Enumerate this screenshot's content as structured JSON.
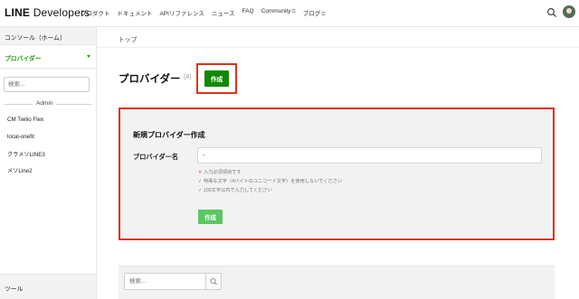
{
  "brand": {
    "line": "LINE",
    "developers": "Developers"
  },
  "nav": {
    "products": "プロダクト",
    "docs": "ドキュメント",
    "api": "APIリファレンス",
    "news": "ニュース",
    "faq": "FAQ",
    "community": "Community",
    "blog": "ブログ"
  },
  "sidebar": {
    "console": "コンソール（ホーム）",
    "providers": "プロバイダー",
    "search_placeholder": "検索...",
    "admin_label": "Admin",
    "items": [
      "CM Twilio Flex",
      "local-onefit",
      "クラメソLINE3",
      "メソLine2"
    ],
    "tools": "ツール"
  },
  "main": {
    "breadcrumb": "トップ",
    "title": "プロバイダー",
    "count": "(4)",
    "create_label": "作成"
  },
  "form": {
    "title": "新規プロバイダー作成",
    "field_label": "プロバイダー名",
    "field_value": "-",
    "messages": [
      {
        "status": "error",
        "text": "入力必須項目です"
      },
      {
        "status": "ok",
        "text": "特殊な文字（4バイトのユニコード文字）を使用しないでください"
      },
      {
        "status": "ok",
        "text": "100文字以内で入力してください"
      }
    ],
    "submit_label": "作成"
  },
  "list": {
    "search_placeholder": "検索..."
  },
  "colors": {
    "accent": "#0f8a00",
    "highlight": "#e0321c",
    "submit_disabled": "#5cc665"
  }
}
